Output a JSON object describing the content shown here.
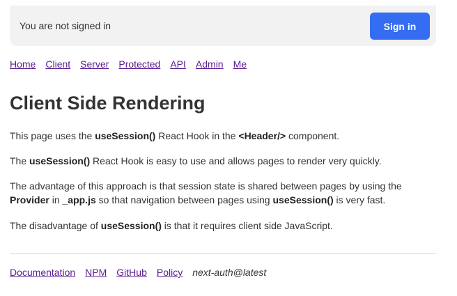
{
  "header": {
    "status_text": "You are not signed in",
    "signin_label": "Sign in"
  },
  "nav": {
    "items": [
      {
        "label": "Home"
      },
      {
        "label": "Client"
      },
      {
        "label": "Server"
      },
      {
        "label": "Protected"
      },
      {
        "label": "API"
      },
      {
        "label": "Admin"
      },
      {
        "label": "Me"
      }
    ]
  },
  "main": {
    "title": "Client Side Rendering",
    "p1": {
      "t1": "This page uses the ",
      "b1": "useSession()",
      "t2": " React Hook in the ",
      "b2": "<Header/>",
      "t3": " component."
    },
    "p2": {
      "t1": "The ",
      "b1": "useSession()",
      "t2": " React Hook is easy to use and allows pages to render very quickly."
    },
    "p3": {
      "t1": "The advantage of this approach is that session state is shared between pages by using the ",
      "b1": "Provider",
      "t2": " in ",
      "b2": "_app.js",
      "t3": " so that navigation between pages using ",
      "b3": "useSession()",
      "t4": " is very fast."
    },
    "p4": {
      "t1": "The disadvantage of ",
      "b1": "useSession()",
      "t2": " is that it requires client side JavaScript."
    }
  },
  "footer": {
    "links": [
      {
        "label": "Documentation"
      },
      {
        "label": "NPM"
      },
      {
        "label": "GitHub"
      },
      {
        "label": "Policy"
      }
    ],
    "version": "next-auth@latest"
  },
  "colors": {
    "accent": "#346df1",
    "link": "#5b1c8e",
    "header_bg": "#f2f2f2"
  }
}
